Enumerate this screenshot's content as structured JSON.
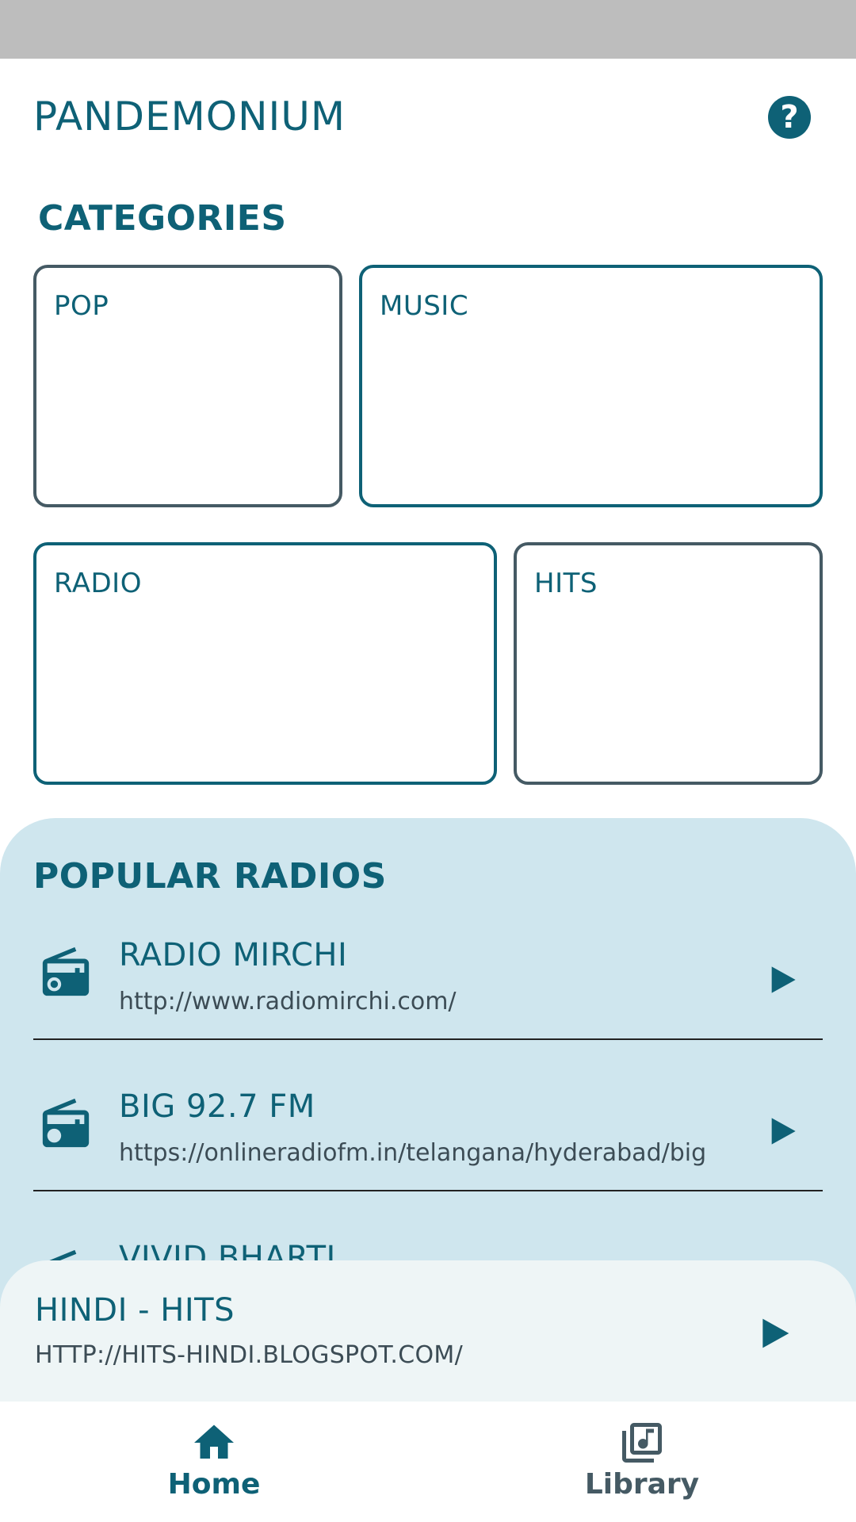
{
  "app": {
    "title": "PANDEMONIUM",
    "help_icon": "help-circle-icon"
  },
  "categories": {
    "heading": "CATEGORIES",
    "items": [
      {
        "label": "POP"
      },
      {
        "label": "MUSIC"
      },
      {
        "label": "RADIO"
      },
      {
        "label": "HITS"
      }
    ]
  },
  "popular": {
    "heading": "POPULAR RADIOS",
    "items": [
      {
        "name": "RADIO MIRCHI",
        "url": "http://www.radiomirchi.com/",
        "icon": "radio-icon",
        "action_icon": "play-icon"
      },
      {
        "name": "BIG 92.7 FM",
        "url": "https://onlineradiofm.in/telangana/hyderabad/big",
        "icon": "radio-icon",
        "action_icon": "play-icon"
      },
      {
        "name": "VIVID BHARTI",
        "url": "",
        "icon": "radio-icon",
        "action_icon": "play-icon"
      }
    ]
  },
  "now_playing": {
    "title": "HINDI - HITS",
    "url": "HTTP://HITS-HINDI.BLOGSPOT.COM/",
    "action_icon": "play-icon"
  },
  "bottom_nav": {
    "items": [
      {
        "label": "Home",
        "icon": "home-icon",
        "active": true
      },
      {
        "label": "Library",
        "icon": "library-music-icon",
        "active": false
      }
    ]
  },
  "colors": {
    "primary": "#0e6176",
    "panel": "#cfe6ee",
    "now_playing_bg": "#eef5f6",
    "status_bar": "#bdbdbd",
    "inactive": "#455a64"
  }
}
